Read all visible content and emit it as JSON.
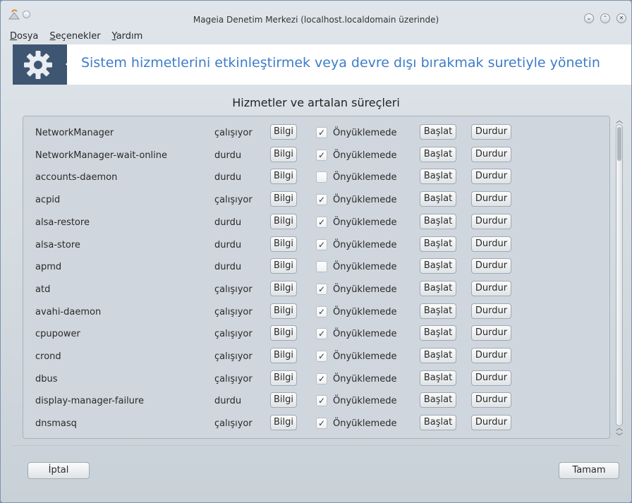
{
  "window": {
    "title": "Mageia Denetim Merkezi  (localhost.localdomain üzerinde)"
  },
  "menu": {
    "items": [
      "Dosya",
      "Seçenekler",
      "Yardım"
    ]
  },
  "banner": {
    "text": "Sistem hizmetlerini etkinleştirmek veya devre dışı bırakmak suretiyle yönetin",
    "icon": "gear-icon"
  },
  "section_title": "Hizmetler ve artalan süreçleri",
  "labels": {
    "info": "Bilgi",
    "onboot": "Önyüklemede",
    "start": "Başlat",
    "stop": "Durdur"
  },
  "services": [
    {
      "name": "NetworkManager",
      "status": "çalışıyor",
      "onboot": true
    },
    {
      "name": "NetworkManager-wait-online",
      "status": "durdu",
      "onboot": true
    },
    {
      "name": "accounts-daemon",
      "status": "durdu",
      "onboot": false
    },
    {
      "name": "acpid",
      "status": "çalışıyor",
      "onboot": true
    },
    {
      "name": "alsa-restore",
      "status": "durdu",
      "onboot": true
    },
    {
      "name": "alsa-store",
      "status": "durdu",
      "onboot": true
    },
    {
      "name": "apmd",
      "status": "durdu",
      "onboot": false
    },
    {
      "name": "atd",
      "status": "çalışıyor",
      "onboot": true
    },
    {
      "name": "avahi-daemon",
      "status": "çalışıyor",
      "onboot": true
    },
    {
      "name": "cpupower",
      "status": "çalışıyor",
      "onboot": true
    },
    {
      "name": "crond",
      "status": "çalışıyor",
      "onboot": true
    },
    {
      "name": "dbus",
      "status": "çalışıyor",
      "onboot": true
    },
    {
      "name": "display-manager-failure",
      "status": "durdu",
      "onboot": true
    },
    {
      "name": "dnsmasq",
      "status": "çalışıyor",
      "onboot": true
    }
  ],
  "footer": {
    "cancel_label": "İptal",
    "ok_label": "Tamam"
  },
  "colors": {
    "banner_text": "#3d7cc9",
    "banner_icon_bg": "#3e5671"
  }
}
